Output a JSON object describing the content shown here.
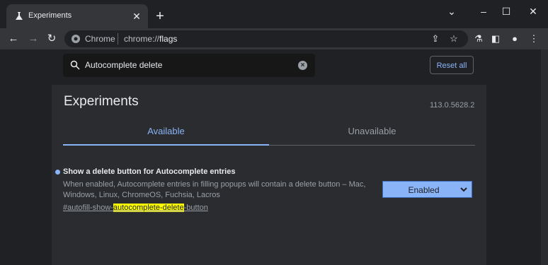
{
  "tab": {
    "title": "Experiments"
  },
  "toolbar": {
    "site_label": "Chrome",
    "url_prefix": "chrome://",
    "url_path": "flags"
  },
  "search": {
    "value": "Autocomplete delete",
    "reset_label": "Reset all"
  },
  "page": {
    "title": "Experiments",
    "version": "113.0.5628.2"
  },
  "tabs": [
    {
      "label": "Available"
    },
    {
      "label": "Unavailable"
    }
  ],
  "flag": {
    "title": "Show a delete button for Autocomplete entries",
    "description": "When enabled, Autocomplete entries in filling popups will contain a delete button – Mac, Windows, Linux, ChromeOS, Fuchsia, Lacros",
    "link_before": "#autofill-show-",
    "link_highlight": "autocomplete-delete",
    "link_after": "-button",
    "selected_option": "Enabled"
  },
  "colors": {
    "accent": "#8ab4f8",
    "highlight": "#ffff00",
    "background": "#202124"
  }
}
